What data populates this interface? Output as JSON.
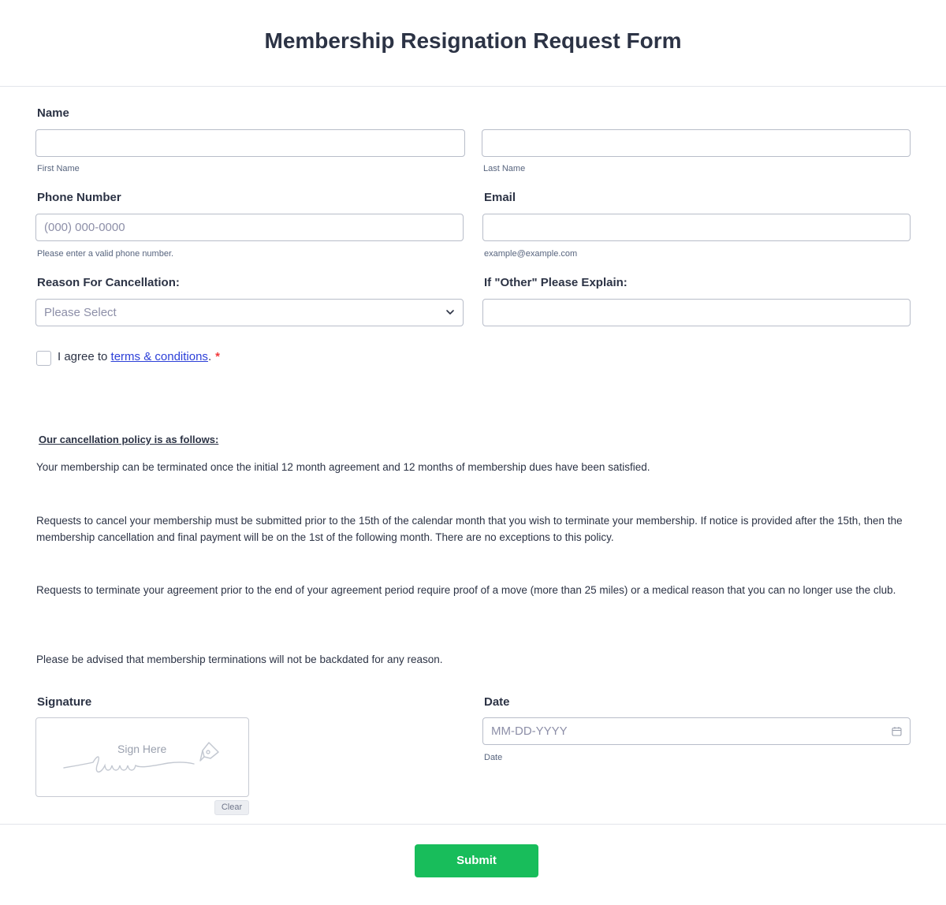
{
  "form": {
    "title": "Membership Resignation Request Form"
  },
  "name": {
    "label": "Name",
    "first_sublabel": "First Name",
    "last_sublabel": "Last Name",
    "first_value": "",
    "last_value": ""
  },
  "phone": {
    "label": "Phone Number",
    "placeholder": "(000) 000-0000",
    "sublabel": "Please enter a valid phone number."
  },
  "email": {
    "label": "Email",
    "value": "",
    "sublabel": "example@example.com"
  },
  "reason": {
    "label": "Reason For Cancellation:",
    "selected": "Please Select"
  },
  "other": {
    "label": "If \"Other\" Please Explain:",
    "value": ""
  },
  "terms": {
    "prefix": "I agree to ",
    "link": "terms & conditions",
    "suffix": ".",
    "required": "*"
  },
  "policy": {
    "heading": "Our cancellation policy is as follows:",
    "p1": "Your membership can be terminated once the initial 12 month agreement and 12 months of membership dues have been satisfied.",
    "p2": "Requests to cancel your membership must be submitted prior to the 15th of the calendar month that you wish to terminate your membership. If notice is provided after the 15th, then the membership cancellation and final payment will be on the 1st of the following month. There are no exceptions to this policy.",
    "p3": "Requests to terminate your agreement prior to the end of your agreement period require proof of a move (more than 25 miles) or a medical reason that you can no longer use the club.",
    "p4": "Please be advised that membership terminations will not be backdated for any reason."
  },
  "signature": {
    "label": "Signature",
    "placeholder": "Sign Here",
    "clear_label": "Clear"
  },
  "date": {
    "label": "Date",
    "placeholder": "MM-DD-YYYY",
    "sublabel": "Date"
  },
  "submit": {
    "label": "Submit"
  },
  "colors": {
    "submit": "#18bd5b",
    "link": "#2c3fd8",
    "required": "#f23a3c",
    "text": "#2c3345"
  },
  "icons": [
    "chevron-down-icon",
    "calendar-icon",
    "pen-nib-icon",
    "signature-scribble-icon"
  ]
}
